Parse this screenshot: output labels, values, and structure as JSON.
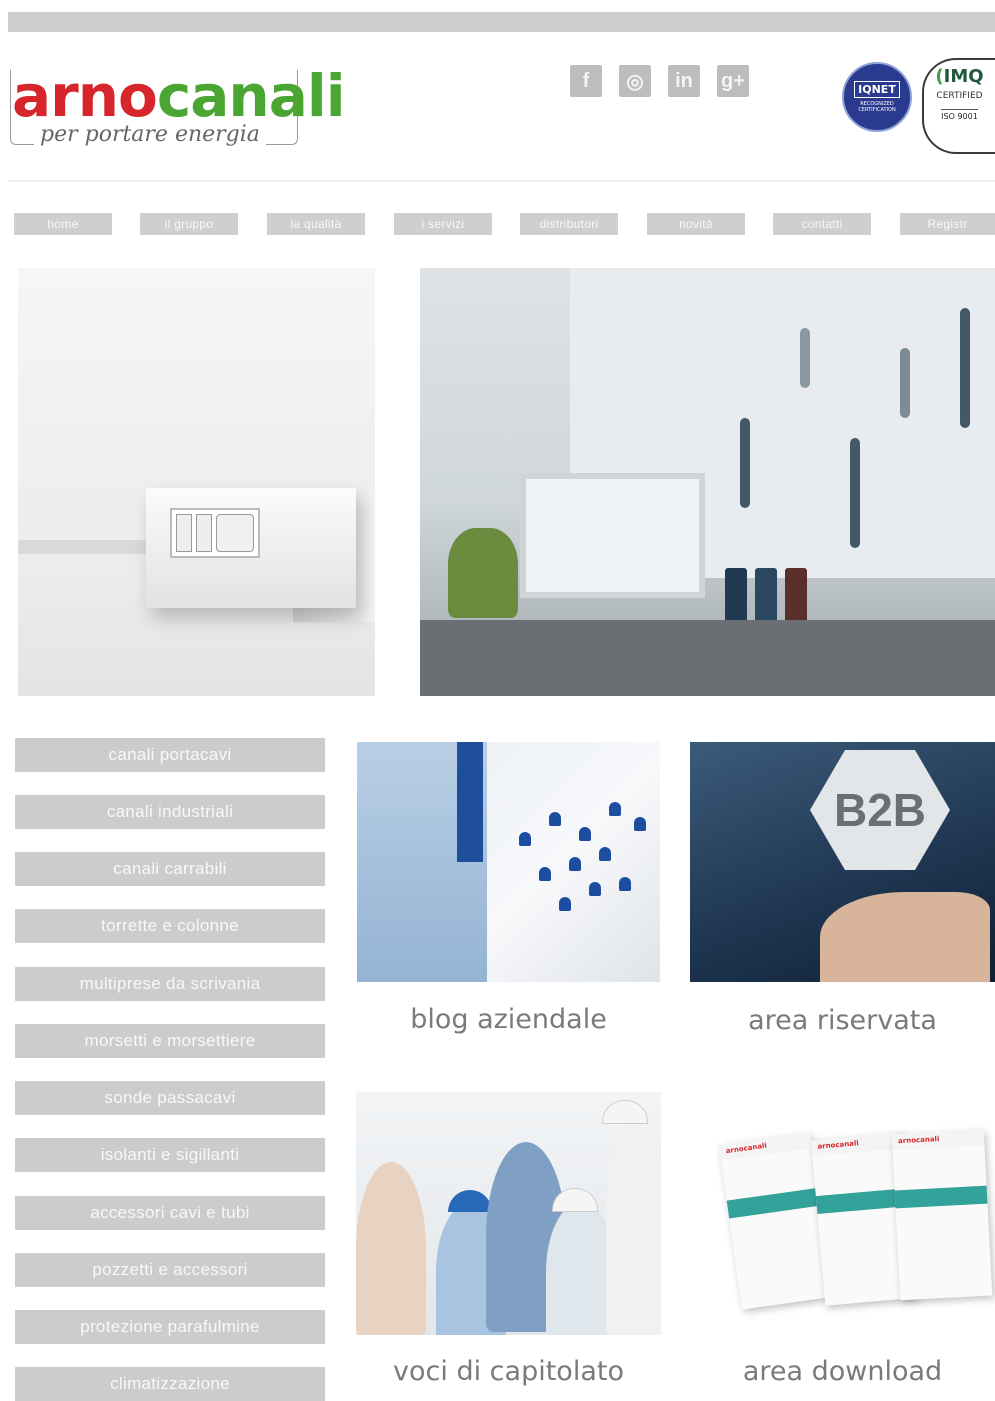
{
  "brand": {
    "name_part1": "arno",
    "name_part2": "canali",
    "tagline": "per portare energia",
    "colors": {
      "red": "#d7262b",
      "green": "#4aa532",
      "gray": "#cfcfcf"
    }
  },
  "social": [
    {
      "icon": "facebook-icon",
      "glyph": "f"
    },
    {
      "icon": "instagram-icon",
      "glyph": "◎"
    },
    {
      "icon": "linkedin-icon",
      "glyph": "in"
    },
    {
      "icon": "google-plus-icon",
      "glyph": "g+"
    }
  ],
  "certifications": {
    "iqnet": {
      "label": "IQNET",
      "sub": "RECOGNIZED CERTIFICATION"
    },
    "imq": {
      "label": "IMQ",
      "certified": "CERTIFIED",
      "iso": "ISO 9001"
    }
  },
  "nav": [
    "home",
    "il gruppo",
    "la qualità",
    "i servizi",
    "distributori",
    "novità",
    "contatti",
    "Registr"
  ],
  "side_menu": [
    "canali portacavi",
    "canali industriali",
    "canali carrabili",
    "torrette e colonne",
    "multiprese da scrivania",
    "morsetti e morsettiere",
    "sonde passacavi",
    "isolanti e sigillanti",
    "accessori cavi e tubi",
    "pozzetti e accessori",
    "protezione parafulmine",
    "climatizzazione"
  ],
  "tiles": {
    "blog": {
      "caption": "blog aziendale"
    },
    "b2b": {
      "caption": "area riservata",
      "badge": "B2B"
    },
    "voci": {
      "caption": "voci di capitolato"
    },
    "download": {
      "caption": "area download",
      "brochure_brand": "arnocanali"
    }
  }
}
